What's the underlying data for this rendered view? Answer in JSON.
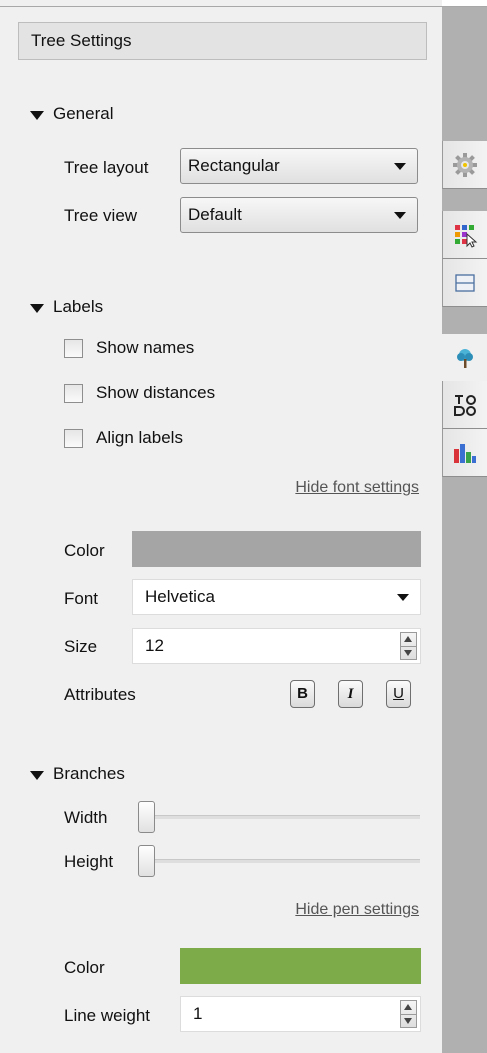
{
  "header": {
    "title": "Tree Settings"
  },
  "general": {
    "title": "General",
    "tree_layout_label": "Tree layout",
    "tree_layout_value": "Rectangular",
    "tree_view_label": "Tree view",
    "tree_view_value": "Default"
  },
  "labels": {
    "title": "Labels",
    "show_names": "Show names",
    "show_distances": "Show distances",
    "align_labels": "Align labels",
    "hide_font_link": "Hide font settings",
    "color_label": "Color",
    "color_value": "#a5a5a5",
    "font_label": "Font",
    "font_value": "Helvetica",
    "size_label": "Size",
    "size_value": "12",
    "attributes_label": "Attributes",
    "bold": "B",
    "italic": "I",
    "underline": "U"
  },
  "branches": {
    "title": "Branches",
    "width_label": "Width",
    "height_label": "Height",
    "hide_pen_link": "Hide pen settings",
    "color_label": "Color",
    "color_value": "#7eab4a",
    "line_weight_label": "Line weight",
    "line_weight_value": "1"
  },
  "sidebar": {
    "tabs": [
      "gear-icon",
      "select-cursor-icon",
      "layout-icon",
      "tree-icon",
      "text-shapes-icon",
      "bar-chart-icon"
    ]
  }
}
